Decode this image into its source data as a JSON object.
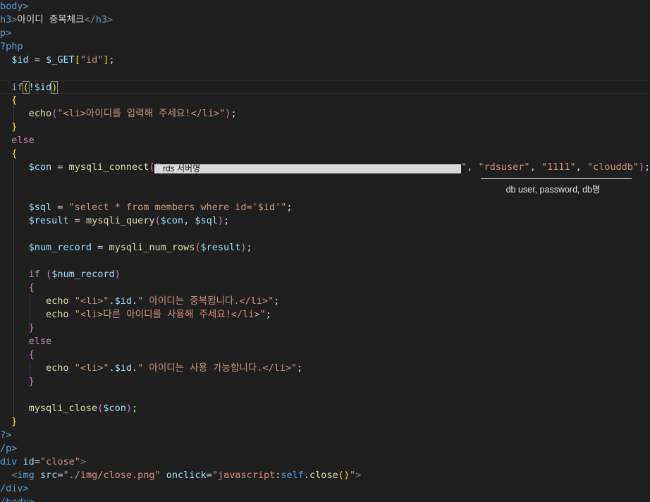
{
  "code": {
    "body_open": "body>",
    "h3_text": "아이디 중복체크",
    "p_open": "p>",
    "php_open": "?php",
    "l_id": {
      "var": "$id",
      "eq": " = ",
      "get": "$_GET",
      "key": "\"id\"",
      "end": ";"
    },
    "l_if1": {
      "kw": "if",
      "expr": "!$id"
    },
    "l_echo_input": {
      "fn": "echo",
      "str": "\"<li>아이디를 입력해 주세요!</li>\""
    },
    "l_else1": "else",
    "l_con": {
      "var": "$con",
      "fn": "mysqli_connect",
      "open_quote": "\"",
      "close_quote": "\"",
      "user": "\"rdsuser\"",
      "password": "\"1111\"",
      "db": "\"clouddb\""
    },
    "l_sql": {
      "var": "$sql",
      "str": "\"select * from members where id='$id'\""
    },
    "l_result": {
      "var": "$result",
      "fn": "mysqli_query",
      "a1": "$con",
      "a2": "$sql"
    },
    "l_num": {
      "var": "$num_record",
      "fn": "mysqli_num_rows",
      "a1": "$result"
    },
    "l_if2": {
      "kw": "if",
      "var": "$num_record"
    },
    "l_echo_dup1": {
      "fn": "echo",
      "s1": "\"<li>\"",
      "var": "$id",
      "s2": "\" 아이디는 중복됩니다.</li>\""
    },
    "l_echo_dup2": {
      "fn": "echo",
      "str": "\"<li>다른 아이디를 사용해 주세요!</li>\""
    },
    "l_else2": "else",
    "l_echo_ok": {
      "fn": "echo",
      "s1": "\"<li>\"",
      "var": "$id",
      "s2": "\" 아이디는 사용 가능합니다.</li>\""
    },
    "l_close": {
      "fn": "mysqli_close",
      "a1": "$con"
    },
    "php_close": "?>",
    "p_close": "/p>",
    "div_open": {
      "tag": "div",
      "attr": "id",
      "val": "\"close\""
    },
    "img": {
      "tag": "img",
      "src_attr": "src",
      "src_val": "\"./img/close.png\"",
      "onclick_attr": "onclick",
      "js_a": "\"javascript",
      "js_b": "self",
      "js_c": "close",
      "js_d": "\""
    },
    "div_close": "/div>",
    "body_close": "/body>"
  },
  "overlays": {
    "redaction_label": "rds 서버명",
    "db_annotation": "db user, password, db명"
  }
}
